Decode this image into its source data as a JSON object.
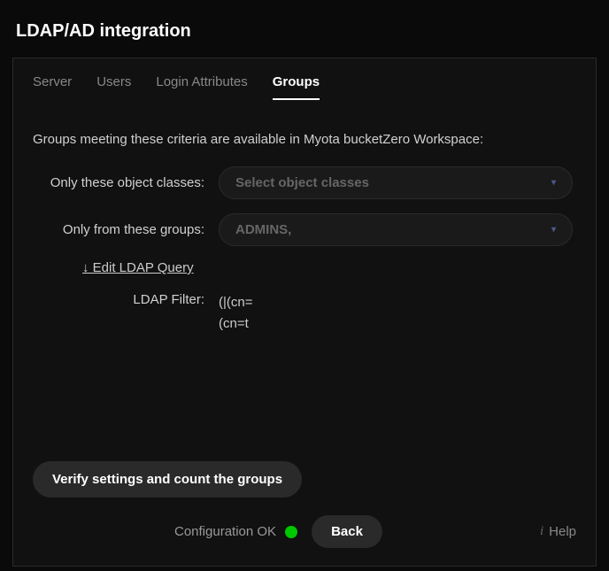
{
  "page_title": "LDAP/AD integration",
  "tabs": {
    "server": "Server",
    "users": "Users",
    "login_attributes": "Login Attributes",
    "groups": "Groups"
  },
  "active_tab": "groups",
  "intro_text": "Groups meeting these criteria are available in Myota bucketZero Workspace:",
  "form": {
    "object_classes_label": "Only these object classes:",
    "object_classes_placeholder": "Select object classes",
    "from_groups_label": "Only from these groups:",
    "from_groups_value": "ADMINS,",
    "edit_query_label": "↓ Edit LDAP Query",
    "ldap_filter_label": "LDAP Filter:",
    "ldap_filter_value": "(|(cn=\n(cn=t"
  },
  "footer": {
    "verify_label": "Verify settings and count the groups",
    "status_text": "Configuration OK",
    "status_color": "#00c800",
    "back_label": "Back",
    "help_label": "Help"
  }
}
